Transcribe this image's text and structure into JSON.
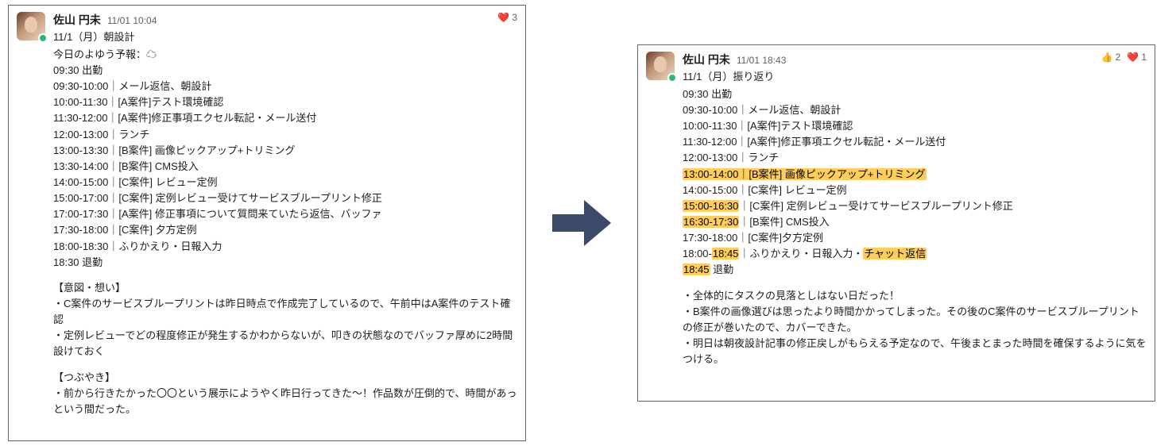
{
  "left": {
    "author": "佐山 円未",
    "timestamp": "11/01 10:04",
    "reactions": [
      {
        "emoji": "❤️",
        "count": 3
      }
    ],
    "title": "11/1（月）朝設計",
    "weather_line": "今日のよゆう予報：☁",
    "schedule": [
      "09:30  出勤",
      "09:30-10:00｜メール返信、朝設計",
      "10:00-11:30｜[A案件]テスト環境確認",
      "11:30-12:00｜[A案件]修正事項エクセル転記・メール送付",
      "12:00-13:00｜ランチ",
      "13:00-13:30｜[B案件] 画像ピックアップ+トリミング",
      "13:30-14:00｜[B案件] CMS投入",
      "14:00-15:00｜[C案件] レビュー定例",
      "15:00-17:00｜[C案件] 定例レビュー受けてサービスブループリント修正",
      "17:00-17:30｜[A案件] 修正事項について質問来ていたら返信、バッファ",
      "17:30-18:00｜[C案件] 夕方定例",
      "18:00-18:30｜ふりかえり・日報入力",
      "18:30  退勤"
    ],
    "section1_heading": "【意図・想い】",
    "section1_lines": [
      "・C案件のサービスブループリントは昨日時点で作成完了しているので、午前中はA案件のテスト確認",
      "・定例レビューでどの程度修正が発生するかわからないが、叩きの状態なのでバッファ厚めに2時間設けておく"
    ],
    "section2_heading": "【つぶやき】",
    "section2_lines": [
      "・前から行きたかった〇〇という展示にようやく昨日行ってきた〜！作品数が圧倒的で、時間があっという間だった。"
    ]
  },
  "right": {
    "author": "佐山 円未",
    "timestamp": "11/01 18:43",
    "reactions": [
      {
        "emoji": "👍",
        "count": 2
      },
      {
        "emoji": "❤️",
        "count": 1
      }
    ],
    "title": "11/1（月）振り返り",
    "schedule": [
      {
        "text": "09:30  出勤"
      },
      {
        "text": "09:30-10:00｜メール返信、朝設計"
      },
      {
        "text": "10:00-11:30｜[A案件]テスト環境確認"
      },
      {
        "text": "11:30-12:00｜[A案件]修正事項エクセル転記・メール送付"
      },
      {
        "text": "12:00-13:00｜ランチ"
      },
      {
        "text": "13:00-14:00｜[B案件] 画像ピックアップ+トリミング",
        "highlight_full": true
      },
      {
        "text": "14:00-15:00｜[C案件] レビュー定例"
      },
      {
        "time_hl": "15:00-16:30",
        "rest": "｜[C案件] 定例レビュー受けてサービスブループリント修正"
      },
      {
        "time_hl": "16:30-17:30",
        "rest": "｜[B案件] CMS投入"
      },
      {
        "text": "17:30-18:00｜[C案件]夕方定例"
      },
      {
        "prefix": "18:00-",
        "time_hl": "18:45",
        "mid": "｜ふりかえり・日報入力・",
        "trail_hl": "チャット返信"
      },
      {
        "time_hl": "18:45",
        "rest": "  退勤"
      }
    ],
    "notes": [
      "・全体的にタスクの見落としはない日だった！",
      "・B案件の画像選びは思ったより時間かかってしまった。その後のC案件のサービスブループリントの修正が巻いたので、カバーできた。",
      "・明日は朝夜設計記事の修正戻しがもらえる予定なので、午後まとまった時間を確保するように気をつける。"
    ]
  },
  "arrow_color": "#3b4a6b"
}
